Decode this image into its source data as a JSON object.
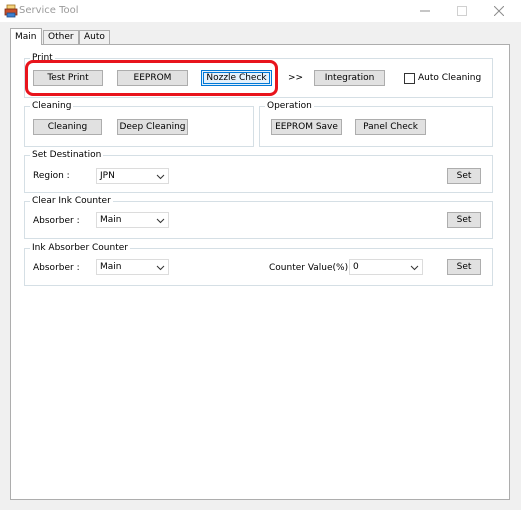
{
  "window": {
    "title": "Service Tool"
  },
  "tabs": [
    {
      "label": "Main"
    },
    {
      "label": "Other"
    },
    {
      "label": "Auto"
    }
  ],
  "print": {
    "title": "Print",
    "test_print": "Test Print",
    "eeprom": "EEPROM",
    "nozzle_check": "Nozzle Check",
    "arrow": ">>",
    "integration": "Integration",
    "auto_cleaning": "Auto Cleaning"
  },
  "cleaning": {
    "title": "Cleaning",
    "cleaning": "Cleaning",
    "deep_cleaning": "Deep Cleaning"
  },
  "operation": {
    "title": "Operation",
    "eeprom_save": "EEPROM Save",
    "panel_check": "Panel Check"
  },
  "set_destination": {
    "title": "Set Destination",
    "region_label": "Region :",
    "region_value": "JPN",
    "set": "Set"
  },
  "clear_ink_counter": {
    "title": "Clear Ink Counter",
    "absorber_label": "Absorber :",
    "absorber_value": "Main",
    "set": "Set"
  },
  "ink_absorber_counter": {
    "title": "Ink Absorber Counter",
    "absorber_label": "Absorber :",
    "absorber_value": "Main",
    "counter_label": "Counter Value(%) :",
    "counter_value": "0",
    "set": "Set"
  },
  "colors": {
    "highlight": "#e8141c",
    "focus": "#0078d7"
  }
}
